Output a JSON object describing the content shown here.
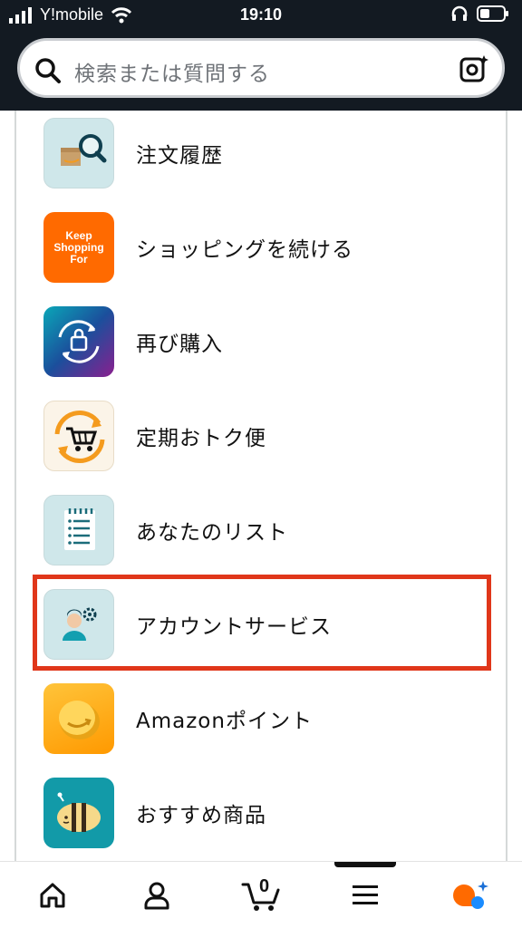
{
  "status_bar": {
    "carrier": "Y!mobile",
    "time": "19:10"
  },
  "search": {
    "placeholder": "検索または質問する"
  },
  "menu_items": [
    {
      "label": "注文履歴",
      "icon": "order-history-icon"
    },
    {
      "label": "ショッピングを続ける",
      "icon": "keep-shopping-icon",
      "icon_text": "Keep Shopping For"
    },
    {
      "label": "再び購入",
      "icon": "buy-again-icon"
    },
    {
      "label": "定期おトク便",
      "icon": "subscribe-save-icon"
    },
    {
      "label": "あなたのリスト",
      "icon": "your-lists-icon"
    },
    {
      "label": "アカウントサービス",
      "icon": "account-service-icon",
      "highlighted": true
    },
    {
      "label": "Amazonポイント",
      "icon": "amazon-points-icon"
    },
    {
      "label": "おすすめ商品",
      "icon": "recommendations-icon"
    }
  ],
  "bottom_nav": {
    "cart_count": "0",
    "tabs": [
      "home-icon",
      "account-icon",
      "cart-icon",
      "menu-icon",
      "rufus-icon"
    ]
  },
  "colors": {
    "header_bg": "#131a22",
    "highlight": "#e0361a",
    "accent_orange": "#ff6a00"
  }
}
